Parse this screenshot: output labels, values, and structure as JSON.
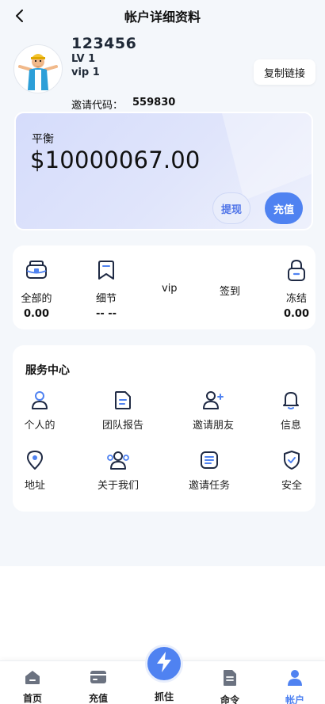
{
  "header": {
    "title": "帐户详细资料"
  },
  "profile": {
    "uid": "123456",
    "level": "LV 1",
    "vip": "vip 1",
    "copy_link_label": "复制链接",
    "invite_label": "邀请代码：",
    "invite_code": "559830"
  },
  "balance": {
    "label": "平衡",
    "value": "$10000067.00",
    "withdraw_label": "提现",
    "recharge_label": "充值"
  },
  "stats": {
    "all_label": "全部的",
    "all_value": "0.00",
    "detail_label": "细节",
    "detail_value": "-- --",
    "vip_label": "vip",
    "checkin_label": "签到",
    "frozen_label": "冻结",
    "frozen_value": "0.00"
  },
  "service": {
    "title": "服务中心",
    "items": [
      {
        "label": "个人的",
        "icon": "user-icon"
      },
      {
        "label": "团队报告",
        "icon": "document-icon"
      },
      {
        "label": "邀请朋友",
        "icon": "add-user-icon"
      },
      {
        "label": "信息",
        "icon": "bell-icon"
      },
      {
        "label": "地址",
        "icon": "location-icon"
      },
      {
        "label": "关于我们",
        "icon": "team-icon"
      },
      {
        "label": "邀请任务",
        "icon": "list-icon"
      },
      {
        "label": "安全",
        "icon": "shield-icon"
      }
    ]
  },
  "nav": {
    "home": "首页",
    "recharge": "充值",
    "grab": "抓住",
    "orders": "命令",
    "account": "帐户"
  },
  "colors": {
    "accent": "#4f82f1",
    "page_bg": "#f4f7fb",
    "card_bg": "#ffffff"
  }
}
